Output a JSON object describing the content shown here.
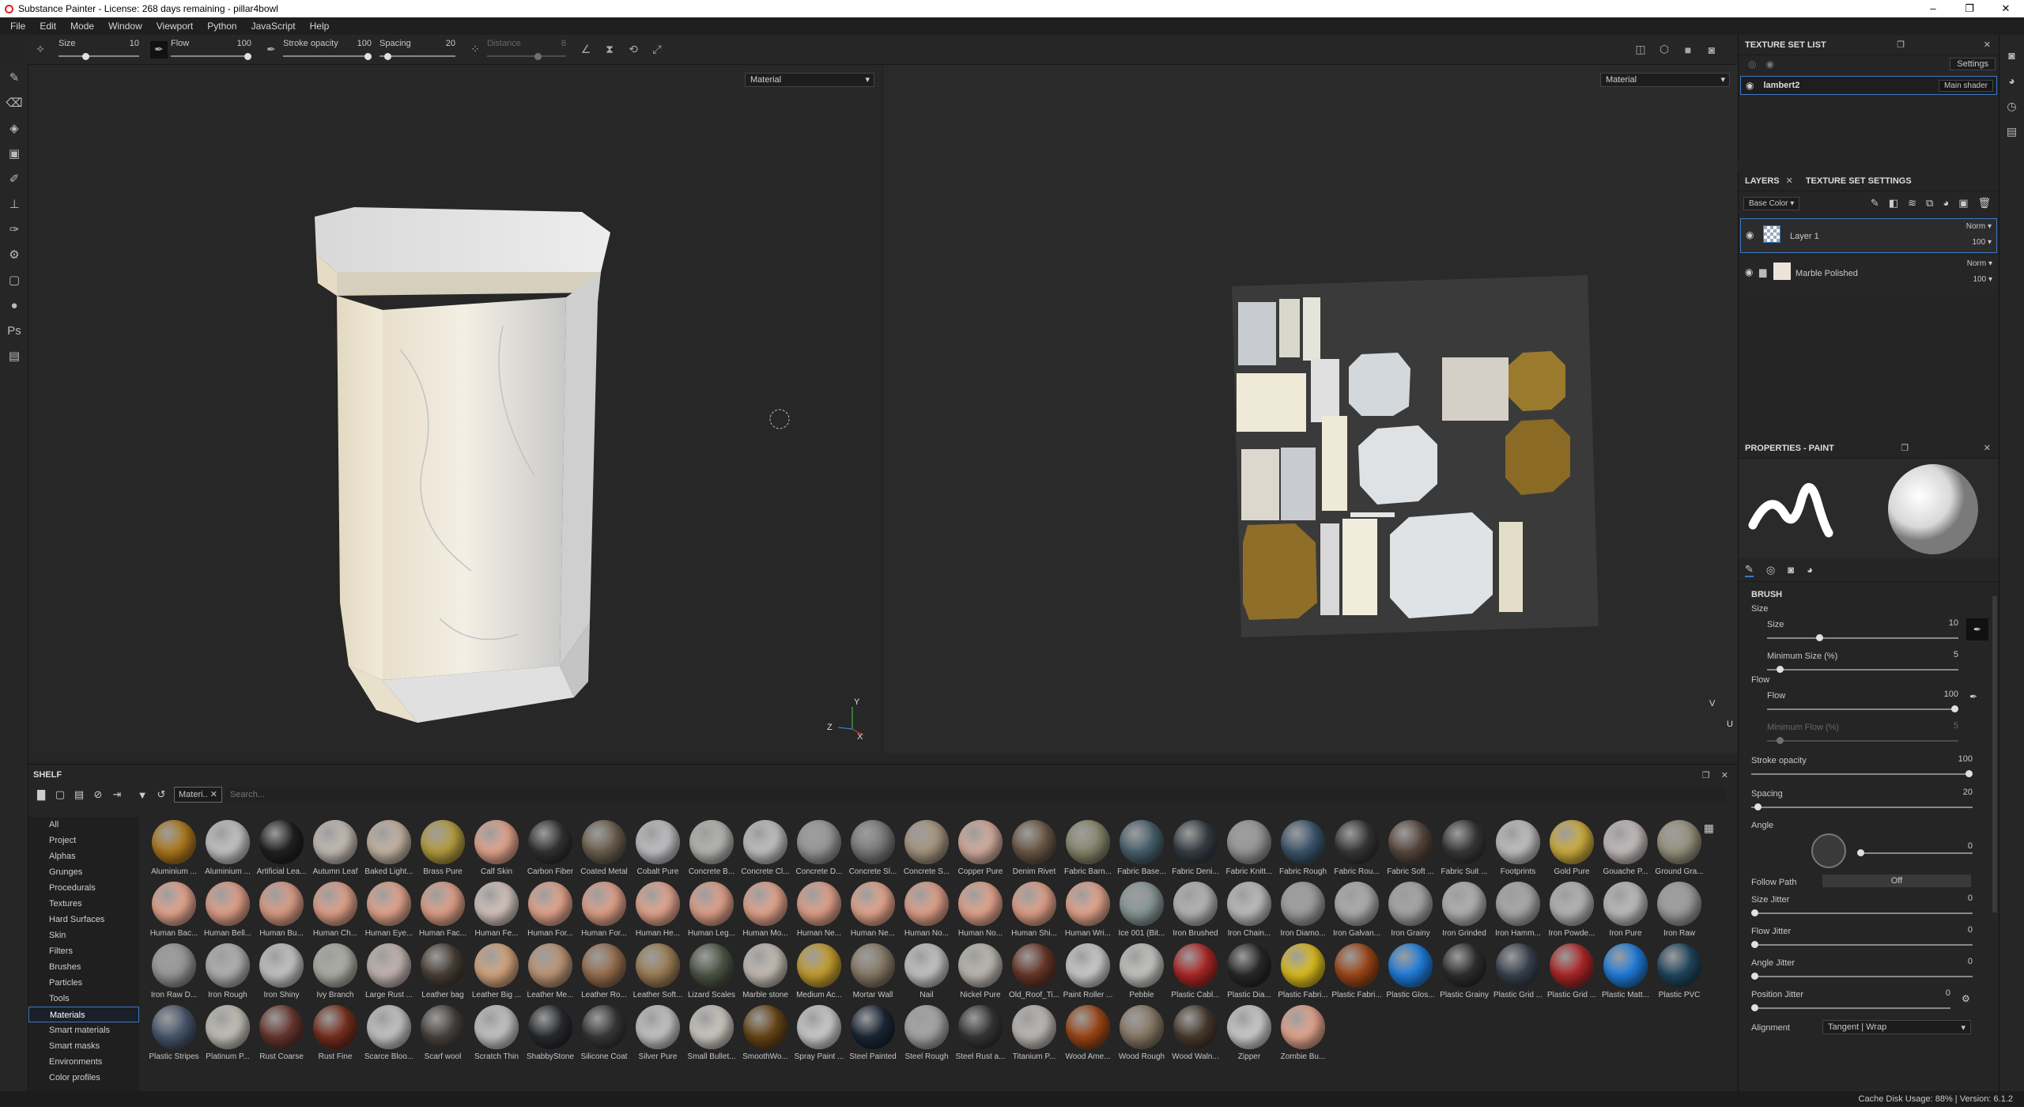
{
  "title": "Substance Painter - License: 268 days remaining - pillar4bowl",
  "window_controls": [
    "–",
    "❐",
    "✕"
  ],
  "menu": [
    "File",
    "Edit",
    "Mode",
    "Window",
    "Viewport",
    "Python",
    "JavaScript",
    "Help"
  ],
  "toolbar": {
    "size_label": "Size",
    "size_value": "10",
    "flow_label": "Flow",
    "flow_value": "100",
    "stroke_label": "Stroke opacity",
    "stroke_value": "100",
    "spacing_label": "Spacing",
    "spacing_value": "20",
    "distance_label": "Distance",
    "distance_value": "8"
  },
  "viewport3d": {
    "mode": "Material",
    "axis_y": "Y",
    "axis_z": "Z",
    "axis_x": "X"
  },
  "viewport2d": {
    "mode": "Material",
    "axis_v": "V",
    "axis_u": "U"
  },
  "texture_set_list": {
    "title": "TEXTURE SET LIST",
    "settings_label": "Settings",
    "set_name": "lambert2",
    "shader": "Main shader"
  },
  "layers_panel": {
    "tab_layers": "LAYERS",
    "tab_settings": "TEXTURE SET SETTINGS",
    "channel": "Base Color",
    "layers": [
      {
        "name": "Layer 1",
        "blend": "Norm",
        "opacity": "100"
      },
      {
        "name": "Marble Polished",
        "blend": "Norm",
        "opacity": "100"
      }
    ]
  },
  "properties": {
    "title": "PROPERTIES - PAINT",
    "brush_header": "BRUSH",
    "size_section": "Size",
    "size_label": "Size",
    "size_value": "10",
    "min_size_label": "Minimum Size (%)",
    "min_size_value": "5",
    "flow_section": "Flow",
    "flow_label": "Flow",
    "flow_value": "100",
    "min_flow_label": "Minimum Flow (%)",
    "min_flow_value": "5",
    "stroke_label": "Stroke opacity",
    "stroke_value": "100",
    "spacing_label": "Spacing",
    "spacing_value": "20",
    "angle_label": "Angle",
    "angle_value": "0",
    "follow_label": "Follow Path",
    "follow_value": "Off",
    "size_jitter_label": "Size Jitter",
    "size_jitter_value": "0",
    "flow_jitter_label": "Flow Jitter",
    "flow_jitter_value": "0",
    "angle_jitter_label": "Angle Jitter",
    "angle_jitter_value": "0",
    "pos_jitter_label": "Position Jitter",
    "pos_jitter_value": "0",
    "alignment_label": "Alignment",
    "alignment_value": "Tangent | Wrap"
  },
  "shelf": {
    "title": "SHELF",
    "filter_tag": "Materi..",
    "search_placeholder": "Search...",
    "categories": [
      "All",
      "Project",
      "Alphas",
      "Grunges",
      "Procedurals",
      "Textures",
      "Hard Surfaces",
      "Skin",
      "Filters",
      "Brushes",
      "Particles",
      "Tools",
      "Materials",
      "Smart materials",
      "Smart masks",
      "Environments",
      "Color profiles"
    ],
    "selected_category": "Materials",
    "materials": [
      {
        "n": "Aluminium ...",
        "c": "#b07a1e"
      },
      {
        "n": "Aluminium ...",
        "c": "#c8c8c8"
      },
      {
        "n": "Artificial Lea...",
        "c": "#222222"
      },
      {
        "n": "Autumn Leaf",
        "c": "#c8c0b8"
      },
      {
        "n": "Baked Light...",
        "c": "#c9b8a6"
      },
      {
        "n": "Brass Pure",
        "c": "#b8a040"
      },
      {
        "n": "Calf Skin",
        "c": "#e8a890"
      },
      {
        "n": "Carbon Fiber",
        "c": "#333333"
      },
      {
        "n": "Coated Metal",
        "c": "#6e6250"
      },
      {
        "n": "Cobalt Pure",
        "c": "#c4c4c8"
      },
      {
        "n": "Concrete B...",
        "c": "#b8b8b4"
      },
      {
        "n": "Concrete Cl...",
        "c": "#c4c4c4"
      },
      {
        "n": "Concrete D...",
        "c": "#9a9a9a"
      },
      {
        "n": "Concrete Sl...",
        "c": "#7c7c7c"
      },
      {
        "n": "Concrete S...",
        "c": "#a89880"
      },
      {
        "n": "Copper Pure",
        "c": "#d8b0a0"
      },
      {
        "n": "Denim Rivet",
        "c": "#6e5a48"
      },
      {
        "n": "Fabric Barn...",
        "c": "#8a8a70"
      },
      {
        "n": "Fabric Base...",
        "c": "#4a6470"
      },
      {
        "n": "Fabric Deni...",
        "c": "#3a4048"
      },
      {
        "n": "Fabric Knitt...",
        "c": "#9a9a9a"
      },
      {
        "n": "Fabric Rough",
        "c": "#3e5870"
      },
      {
        "n": "Fabric Rou...",
        "c": "#383838"
      },
      {
        "n": "Fabric Soft ...",
        "c": "#5a4a40"
      },
      {
        "n": "Fabric Suit ...",
        "c": "#3a3a3a"
      },
      {
        "n": "Footprints",
        "c": "#c4c4c4"
      },
      {
        "n": "Gold Pure",
        "c": "#d0b040"
      },
      {
        "n": "Gouache P...",
        "c": "#c8c0c0"
      },
      {
        "n": "Ground Gra...",
        "c": "#9a9680"
      },
      {
        "n": "Human Bac...",
        "c": "#e8a890"
      },
      {
        "n": "Human Bell...",
        "c": "#e4a48c"
      },
      {
        "n": "Human Bu...",
        "c": "#e0a088"
      },
      {
        "n": "Human Ch...",
        "c": "#e4a48c"
      },
      {
        "n": "Human Eye...",
        "c": "#e8a890"
      },
      {
        "n": "Human Fac...",
        "c": "#e4a48c"
      },
      {
        "n": "Human Fe...",
        "c": "#d8c8c0"
      },
      {
        "n": "Human For...",
        "c": "#e8a890"
      },
      {
        "n": "Human For...",
        "c": "#e4a48c"
      },
      {
        "n": "Human He...",
        "c": "#e8a890"
      },
      {
        "n": "Human Leg...",
        "c": "#e4a48c"
      },
      {
        "n": "Human Mo...",
        "c": "#e8a890"
      },
      {
        "n": "Human Ne...",
        "c": "#e4a48c"
      },
      {
        "n": "Human Ne...",
        "c": "#e8a890"
      },
      {
        "n": "Human No...",
        "c": "#e4a48c"
      },
      {
        "n": "Human No...",
        "c": "#e8a890"
      },
      {
        "n": "Human Shi...",
        "c": "#e4a48c"
      },
      {
        "n": "Human Wri...",
        "c": "#e8a890"
      },
      {
        "n": "Ice 001 (Bit...",
        "c": "#8a9a98"
      },
      {
        "n": "Iron Brushed",
        "c": "#b8b8b8"
      },
      {
        "n": "Iron Chain...",
        "c": "#c0c0c0"
      },
      {
        "n": "Iron Diamo...",
        "c": "#a0a0a0"
      },
      {
        "n": "Iron Galvan...",
        "c": "#b0b0b0"
      },
      {
        "n": "Iron Grainy",
        "c": "#a8a8a8"
      },
      {
        "n": "Iron Grinded",
        "c": "#b4b4b4"
      },
      {
        "n": "Iron Hamm...",
        "c": "#acacac"
      },
      {
        "n": "Iron Powde...",
        "c": "#b8b8b8"
      },
      {
        "n": "Iron Pure",
        "c": "#c0c0c0"
      },
      {
        "n": "Iron Raw",
        "c": "#a0a0a0"
      },
      {
        "n": "Iron Raw D...",
        "c": "#9a9a9a"
      },
      {
        "n": "Iron Rough",
        "c": "#b4b4b4"
      },
      {
        "n": "Iron Shiny",
        "c": "#c8c8c8"
      },
      {
        "n": "Ivy Branch",
        "c": "#b0b0a8"
      },
      {
        "n": "Large Rust ...",
        "c": "#c8b8b4"
      },
      {
        "n": "Leather bag",
        "c": "#4a4038"
      },
      {
        "n": "Leather Big ...",
        "c": "#d8a880"
      },
      {
        "n": "Leather Me...",
        "c": "#c09878"
      },
      {
        "n": "Leather Ro...",
        "c": "#9a7050"
      },
      {
        "n": "Leather Soft...",
        "c": "#a08058"
      },
      {
        "n": "Lizard Scales",
        "c": "#505848"
      },
      {
        "n": "Marble stone",
        "c": "#c8c0b8"
      },
      {
        "n": "Medium Ac...",
        "c": "#c8a030"
      },
      {
        "n": "Mortar Wall",
        "c": "#8a7c68"
      },
      {
        "n": "Nail",
        "c": "#c8c8c8"
      },
      {
        "n": "Nickel Pure",
        "c": "#c0bcb4"
      },
      {
        "n": "Old_Roof_Ti...",
        "c": "#6a3828"
      },
      {
        "n": "Paint Roller ...",
        "c": "#d0d0d0"
      },
      {
        "n": "Pebble",
        "c": "#c8c8c4"
      },
      {
        "n": "Plastic Cabl...",
        "c": "#b02828"
      },
      {
        "n": "Plastic Dia...",
        "c": "#2a2a2a"
      },
      {
        "n": "Plastic Fabri...",
        "c": "#e0c020"
      },
      {
        "n": "Plastic Fabri...",
        "c": "#a04818"
      },
      {
        "n": "Plastic Glos...",
        "c": "#2080e0"
      },
      {
        "n": "Plastic Grainy",
        "c": "#303030"
      },
      {
        "n": "Plastic Grid ...",
        "c": "#3a4450"
      },
      {
        "n": "Plastic Grid ...",
        "c": "#b02828"
      },
      {
        "n": "Plastic Matt...",
        "c": "#2080e0"
      },
      {
        "n": "Plastic PVC",
        "c": "#204860"
      },
      {
        "n": "Plastic Stripes",
        "c": "#4a5a70"
      },
      {
        "n": "Platinum P...",
        "c": "#c8c4bc"
      },
      {
        "n": "Rust Coarse",
        "c": "#6a3830"
      },
      {
        "n": "Rust Fine",
        "c": "#7a3020"
      },
      {
        "n": "Scarce Bloo...",
        "c": "#c8c8c8"
      },
      {
        "n": "Scarf wool",
        "c": "#4a4440"
      },
      {
        "n": "Scratch Thin",
        "c": "#c8c8c8"
      },
      {
        "n": "ShabbyStone",
        "c": "#2a2c30"
      },
      {
        "n": "Silicone Coat",
        "c": "#3a3a3a"
      },
      {
        "n": "Silver Pure",
        "c": "#c8c8c8"
      },
      {
        "n": "Small Bullet...",
        "c": "#d0ccc4"
      },
      {
        "n": "SmoothWo...",
        "c": "#6a4818"
      },
      {
        "n": "Spray Paint ...",
        "c": "#d0d0d0"
      },
      {
        "n": "Steel Painted",
        "c": "#1c2838"
      },
      {
        "n": "Steel Rough",
        "c": "#a8a8a8"
      },
      {
        "n": "Steel Rust a...",
        "c": "#383838"
      },
      {
        "n": "Titanium P...",
        "c": "#c0bcb8"
      },
      {
        "n": "Wood Ame...",
        "c": "#a04818"
      },
      {
        "n": "Wood Rough",
        "c": "#8a7c68"
      },
      {
        "n": "Wood Waln...",
        "c": "#4a3c30"
      },
      {
        "n": "Zipper",
        "c": "#d0d0d0"
      },
      {
        "n": "Zombie Bu...",
        "c": "#e8a890"
      }
    ]
  },
  "status": "Cache Disk Usage:   88% | Version: 6.1.2"
}
